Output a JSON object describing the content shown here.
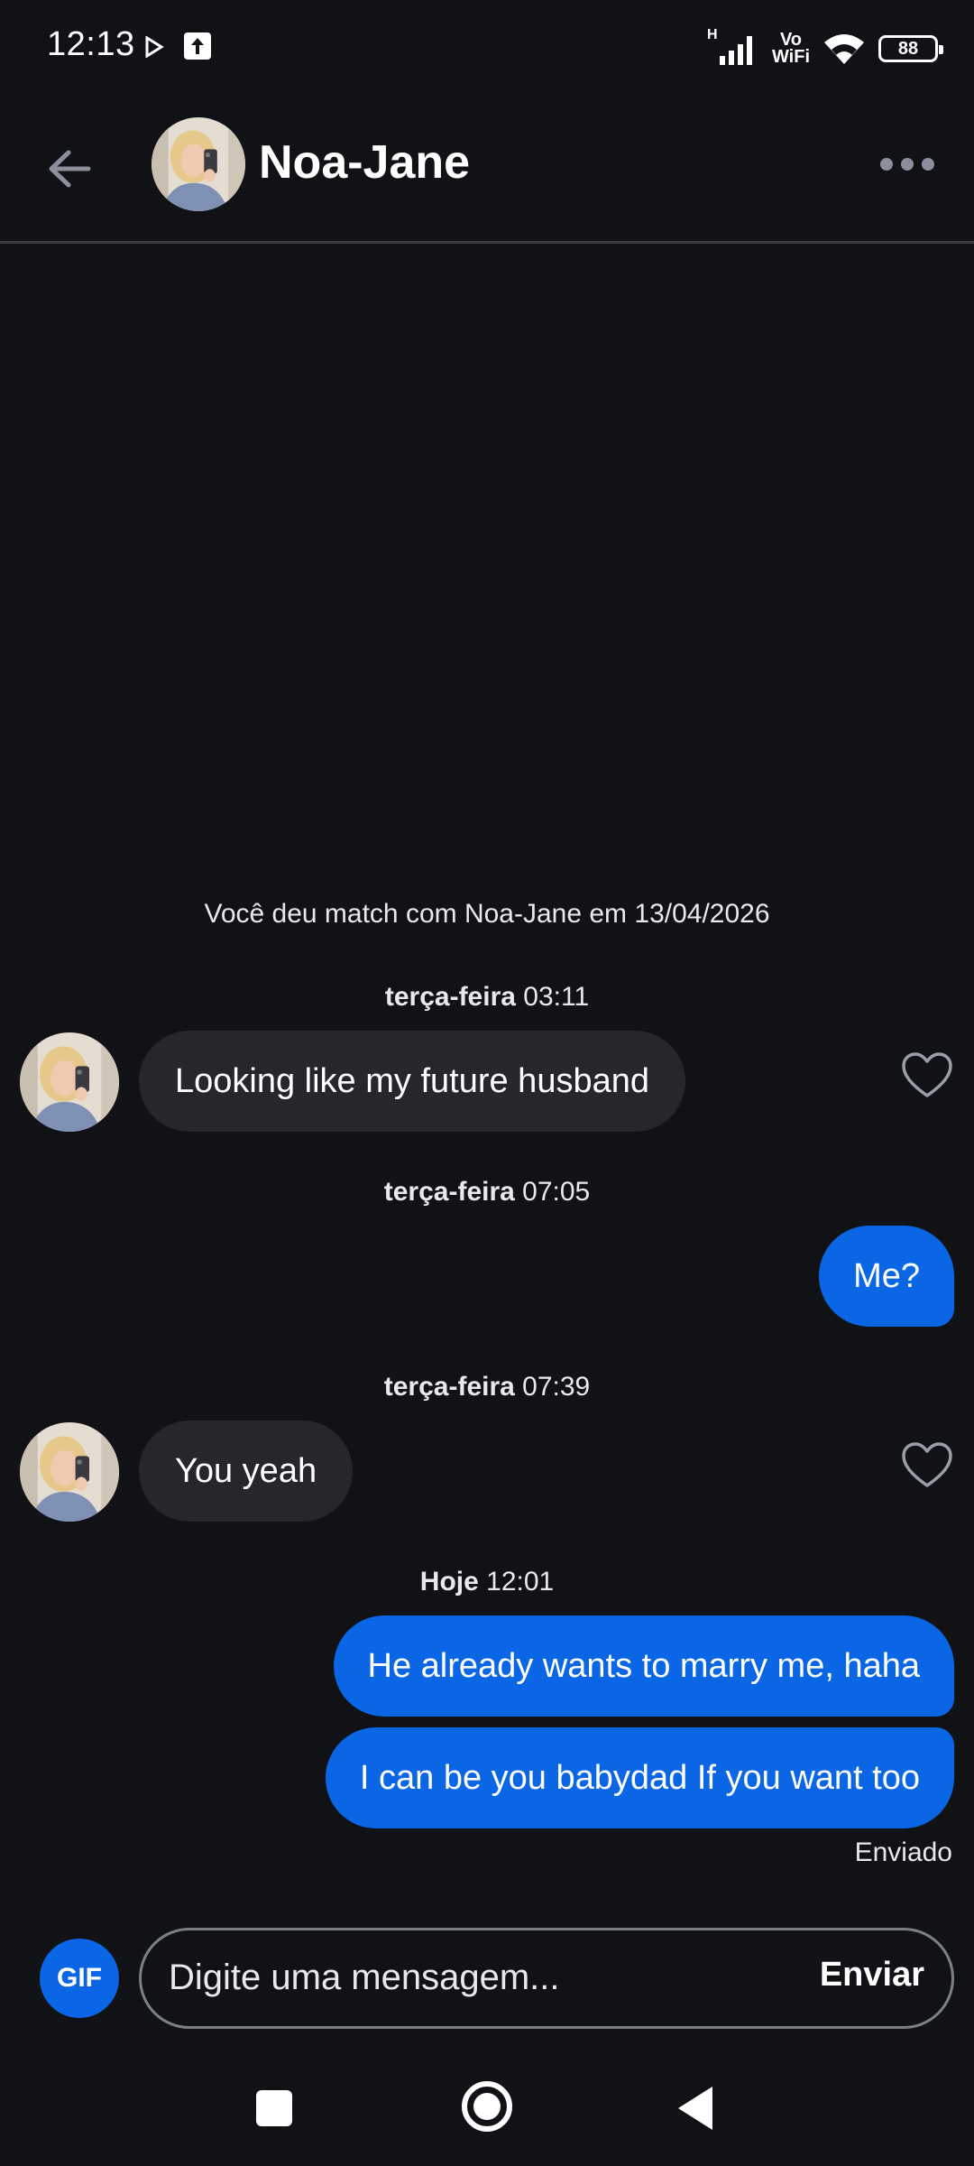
{
  "status_bar": {
    "time": "12:13",
    "network": "H",
    "vowifi_top": "Vo",
    "vowifi_bottom": "WiFi",
    "battery": "88",
    "icons": [
      "play-icon",
      "upload-icon",
      "signal-icon",
      "wifi-icon",
      "battery-icon"
    ]
  },
  "header": {
    "name": "Noa-Jane",
    "icons": [
      "back-arrow-icon",
      "more-icon"
    ]
  },
  "chat": {
    "match_notice": "Você deu match com Noa-Jane em 13/04/2026",
    "groups": [
      {
        "day": "terça-feira",
        "time": "03:11"
      },
      {
        "day": "terça-feira",
        "time": "07:05"
      },
      {
        "day": "terça-feira",
        "time": "07:39"
      },
      {
        "day": "Hoje",
        "time": "12:01"
      }
    ],
    "messages": [
      {
        "from": "them",
        "text": "Looking like my future husband"
      },
      {
        "from": "me",
        "text": "Me?"
      },
      {
        "from": "them",
        "text": "You yeah"
      },
      {
        "from": "me",
        "text": "He already wants to marry me, haha"
      },
      {
        "from": "me",
        "text": "I can be you babydad If you want too"
      }
    ],
    "sent_status": "Enviado"
  },
  "composer": {
    "gif_label": "GIF",
    "placeholder": "Digite uma mensagem...",
    "send_label": "Enviar"
  },
  "colors": {
    "background": "#111216",
    "incoming_bubble": "#26272d",
    "outgoing_bubble": "#0a66e4",
    "accent": "#0a66e4"
  }
}
